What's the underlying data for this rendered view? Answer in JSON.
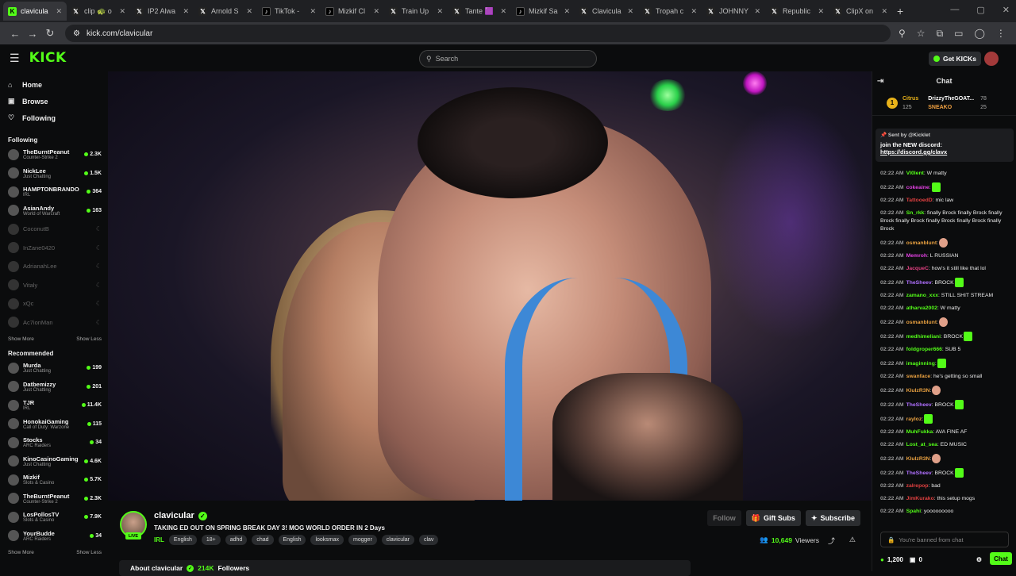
{
  "browser": {
    "tabs": [
      {
        "label": "claviculа",
        "icon": "kick-icon",
        "active": true
      },
      {
        "label": "clip 🐢 o",
        "icon": "x-icon"
      },
      {
        "label": "IP2 Alwa",
        "icon": "x-icon"
      },
      {
        "label": "Arnold S",
        "icon": "x-icon"
      },
      {
        "label": "TikTok - ",
        "icon": "tiktok-icon"
      },
      {
        "label": "Mizkif Cl",
        "icon": "tiktok-icon"
      },
      {
        "label": "Train Up",
        "icon": "x-icon"
      },
      {
        "label": "Tante 🟪",
        "icon": "x-icon"
      },
      {
        "label": "Mizkif Sa",
        "icon": "tiktok-icon"
      },
      {
        "label": "Claviculа",
        "icon": "x-icon"
      },
      {
        "label": "Tropah c",
        "icon": "x-icon"
      },
      {
        "label": "JOHNNY c",
        "icon": "x-icon"
      },
      {
        "label": "Republic",
        "icon": "x-icon"
      },
      {
        "label": "ClipX on",
        "icon": "x-icon"
      }
    ],
    "url": "kick.com/clavicular"
  },
  "header": {
    "logo": "KICK",
    "search_placeholder": "Search",
    "get_kicks": "Get KICKs"
  },
  "sidebar": {
    "nav": [
      {
        "label": "Home",
        "icon": "home-icon"
      },
      {
        "label": "Browse",
        "icon": "browse-icon"
      },
      {
        "label": "Following",
        "icon": "heart-icon"
      }
    ],
    "following_title": "Following",
    "following": [
      {
        "name": "TheBurntPeanut",
        "category": "Counter-Strike 2",
        "viewers": "2.3K",
        "live": true
      },
      {
        "name": "NickLee",
        "category": "Just Chatting",
        "viewers": "1.5K",
        "live": true
      },
      {
        "name": "HAMPTONBRANDO",
        "category": "IRL",
        "viewers": "364",
        "live": true
      },
      {
        "name": "AsianAndy",
        "category": "World of Warcraft",
        "viewers": "163",
        "live": true
      },
      {
        "name": "CoconutB",
        "category": "",
        "viewers": "☾",
        "live": false
      },
      {
        "name": "InZane0420",
        "category": "",
        "viewers": "☾",
        "live": false
      },
      {
        "name": "AdrianahLee",
        "category": "",
        "viewers": "☾",
        "live": false
      },
      {
        "name": "Vitaly",
        "category": "",
        "viewers": "☾",
        "live": false
      },
      {
        "name": "xQc",
        "category": "",
        "viewers": "☾",
        "live": false
      },
      {
        "name": "Ac7ionMan",
        "category": "",
        "viewers": "☾",
        "live": false
      }
    ],
    "show_more": "Show More",
    "show_less": "Show Less",
    "recommended_title": "Recommended",
    "recommended": [
      {
        "name": "Murda",
        "category": "Just Chatting",
        "viewers": "199"
      },
      {
        "name": "Datbemizzy",
        "category": "Just Chatting",
        "viewers": "201"
      },
      {
        "name": "TJR",
        "category": "IRL",
        "viewers": "11.4K"
      },
      {
        "name": "HonokaiGaming",
        "category": "Call of Duty: Warzone",
        "viewers": "115"
      },
      {
        "name": "Stocks",
        "category": "ARC Raiders",
        "viewers": "34"
      },
      {
        "name": "KinoCasinoGaming",
        "category": "Just Chatting",
        "viewers": "4.6K"
      },
      {
        "name": "Mizkif",
        "category": "Slots & Casino",
        "viewers": "5.7K"
      },
      {
        "name": "TheBurntPeanut",
        "category": "Counter-Strike 2",
        "viewers": "2.3K"
      },
      {
        "name": "LosPollosTV",
        "category": "Slots & Casino",
        "viewers": "7.9K"
      },
      {
        "name": "YourBudde",
        "category": "ARC Raiders",
        "viewers": "34"
      }
    ]
  },
  "channel": {
    "name": "clavicular",
    "live_badge": "LIVE",
    "title": "TAKING ED OUT ON SPRING BREAK DAY 3! MOG WORLD ORDER IN 2 Days",
    "category": "IRL",
    "tags": [
      "English",
      "18+",
      "adhd",
      "chad",
      "English",
      "looksmax",
      "mogger",
      "clavicular",
      "clav"
    ],
    "follow": "Follow",
    "gift_subs": "Gift Subs",
    "subscribe": "Subscribe",
    "viewers_count": "10,649",
    "viewers_label": "Viewers",
    "about_label": "About clavicular",
    "followers_count": "214K",
    "followers_label": "Followers"
  },
  "chat": {
    "title": "Chat",
    "gifters": {
      "badge": "1",
      "top1_name": "Citrus",
      "top1_count": "125",
      "top2_name": "DrizzyTheGOAT...",
      "top2_count": "78",
      "top3_name": "SNEAKO",
      "top3_count": "25"
    },
    "pinned": {
      "sent_by": "Sent by",
      "sender": "@Kicklet",
      "text": "join the NEW discord:",
      "link": "https://discord.gg/clavx"
    },
    "messages": [
      {
        "time": "02:22 AM",
        "user": "VI0lent",
        "color": "#53fc18",
        "text": ": W matty"
      },
      {
        "time": "02:22 AM",
        "user": "cokeaine",
        "color": "#e040e0",
        "text": ":",
        "emote": "w"
      },
      {
        "time": "02:22 AM",
        "user": "TattooedD",
        "color": "#e04040",
        "text": ": mic law"
      },
      {
        "time": "02:22 AM",
        "user": "Sn_rkk",
        "color": "#53fc18",
        "text": ": finally Brock finally Brock finally Brock finally Brock finally Brock finally Brock finally Brock"
      },
      {
        "time": "02:22 AM",
        "user": "osmanblunt",
        "color": "#e8a040",
        "text": ":",
        "emote": "hand"
      },
      {
        "time": "02:22 AM",
        "user": "Memroh",
        "color": "#e040e0",
        "text": ": L RUSSIAN"
      },
      {
        "time": "02:22 AM",
        "user": "JacqueC",
        "color": "#e04080",
        "text": ": how's it still like that lol"
      },
      {
        "time": "02:22 AM",
        "user": "TheSheev",
        "color": "#b070ff",
        "text": ": BROCK",
        "emote": "w"
      },
      {
        "time": "02:22 AM",
        "user": "zamano_xxx",
        "color": "#53fc18",
        "text": ": STILL SHIT STREAM"
      },
      {
        "time": "02:22 AM",
        "user": "atharva2002",
        "color": "#53fc18",
        "text": ": W matty"
      },
      {
        "time": "02:22 AM",
        "user": "osmanblunt",
        "color": "#e8a040",
        "text": ":",
        "emote": "hand"
      },
      {
        "time": "02:22 AM",
        "user": "medhimeliani",
        "color": "#53fc18",
        "text": ": BROCK",
        "emote": "w"
      },
      {
        "time": "02:22 AM",
        "user": "foldgroper666",
        "color": "#53fc18",
        "text": ": SUB 5"
      },
      {
        "time": "02:22 AM",
        "user": "imaginning",
        "color": "#53fc18",
        "text": ":",
        "emote": "w"
      },
      {
        "time": "02:22 AM",
        "user": "swanface",
        "color": "#e8a040",
        "text": ": he's getting so small"
      },
      {
        "time": "02:22 AM",
        "user": "KlulzR3N",
        "color": "#e8a040",
        "text": ":",
        "emote": "hand"
      },
      {
        "time": "02:22 AM",
        "user": "TheSheev",
        "color": "#b070ff",
        "text": ": BROCK",
        "emote": "w"
      },
      {
        "time": "02:22 AM",
        "user": "rayloz",
        "color": "#e8a040",
        "text": ":",
        "emote": "w"
      },
      {
        "time": "02:22 AM",
        "user": "MuhFukka",
        "color": "#53fc18",
        "text": ": AVA FINE AF"
      },
      {
        "time": "02:22 AM",
        "user": "Lost_at_sea",
        "color": "#53fc18",
        "text": ": ED MUSIC"
      },
      {
        "time": "02:22 AM",
        "user": "KlulzR3N",
        "color": "#e8a040",
        "text": ":",
        "emote": "hand"
      },
      {
        "time": "02:22 AM",
        "user": "TheSheev",
        "color": "#b070ff",
        "text": ": BROCK",
        "emote": "w"
      },
      {
        "time": "02:22 AM",
        "user": "zalrepop",
        "color": "#e04040",
        "text": ": bad"
      },
      {
        "time": "02:22 AM",
        "user": "JimKurako",
        "color": "#e04040",
        "text": ": this setup mogs"
      },
      {
        "time": "02:22 AM",
        "user": "Spahi",
        "color": "#53fc18",
        "text": ": yooooooooo"
      }
    ],
    "input_placeholder": "You're banned from chat",
    "kicks_balance": "1,200",
    "other_count": "0",
    "chat_button": "Chat"
  }
}
